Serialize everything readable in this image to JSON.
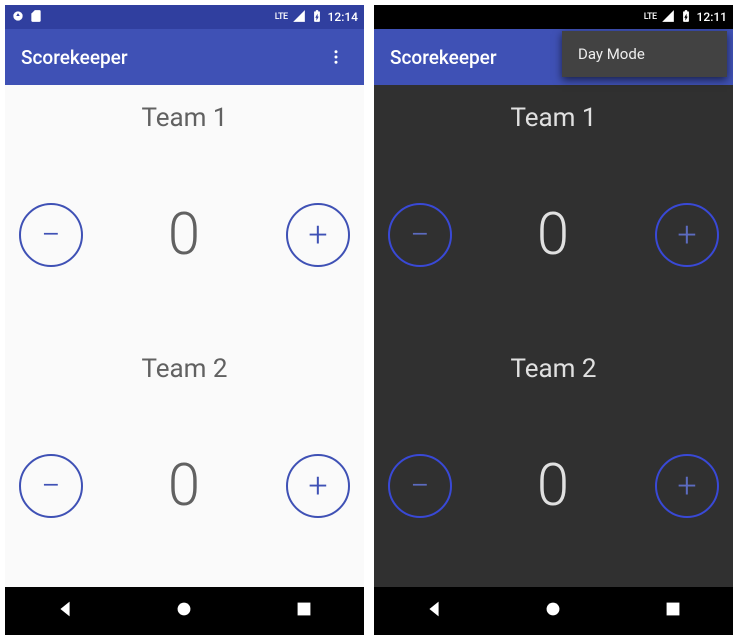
{
  "left": {
    "theme": "light",
    "status_time": "12:14",
    "app_title": "Scorekeeper",
    "team1_label": "Team 1",
    "team1_score": "0",
    "team2_label": "Team 2",
    "team2_score": "0",
    "minus": "−",
    "plus": "+"
  },
  "right": {
    "theme": "dark",
    "status_time": "12:11",
    "app_title": "Scorekeeper",
    "menu_item": "Day Mode",
    "team1_label": "Team 1",
    "team1_score": "0",
    "team2_label": "Team 2",
    "team2_score": "0",
    "minus": "−",
    "plus": "+"
  },
  "icons": {
    "lte": "LTE",
    "battery": "⚡"
  }
}
